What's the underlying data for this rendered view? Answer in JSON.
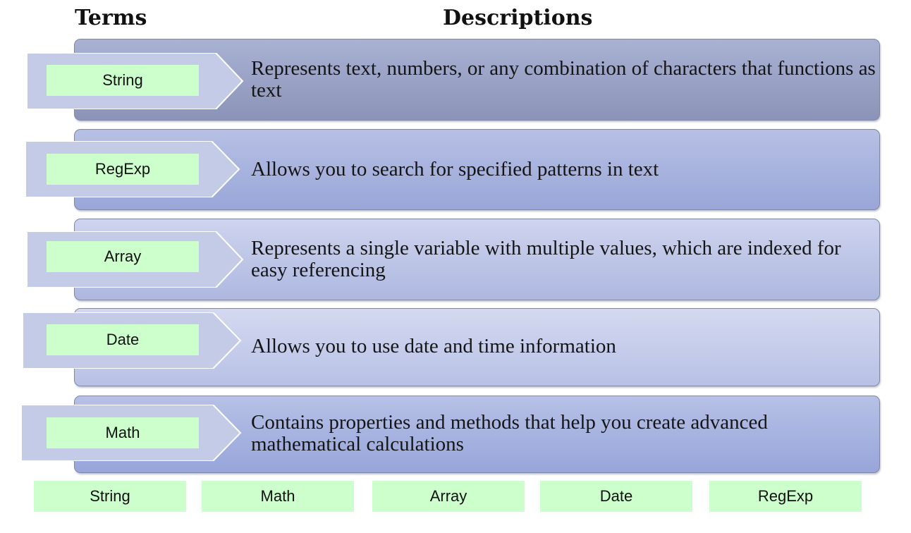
{
  "headings": {
    "terms": "Terms",
    "descriptions": "Descriptions"
  },
  "rows": [
    {
      "term": "String",
      "description": "Represents text, numbers, or any combination of characters that functions as text",
      "panel_gradient": [
        "#a9b2d3",
        "#8b93b8"
      ]
    },
    {
      "term": "RegExp",
      "description": "Allows you to search for specified patterns in text",
      "panel_gradient": [
        "#b7c0e4",
        "#99a6d8"
      ]
    },
    {
      "term": "Array",
      "description": "Represents a single variable with multiple values, which are indexed for easy referencing",
      "panel_gradient": [
        "#ced4ee",
        "#aeb8e0"
      ]
    },
    {
      "term": "Date",
      "description": "Allows you to use date and time information",
      "panel_gradient": [
        "#d4d9f0",
        "#b8c1e6"
      ]
    },
    {
      "term": "Math",
      "description": "Contains properties and methods that help you create advanced mathematical calculations",
      "panel_gradient": [
        "#b7c1e6",
        "#97a5da"
      ]
    }
  ],
  "chips": [
    "String",
    "Math",
    "Array",
    "Date",
    "RegExp"
  ],
  "colors": {
    "term_fill": "#ccffcc",
    "chevron_fill": "#c3cbe6",
    "chevron_stroke": "#ffffff"
  }
}
